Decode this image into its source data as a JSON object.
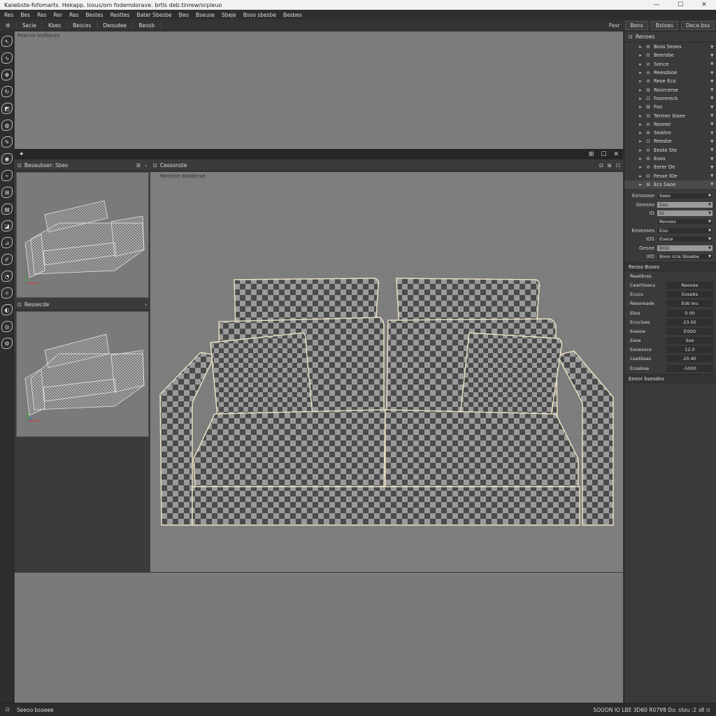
{
  "window": {
    "title": "Kaiwbste-fofomarts. Hekapp. losus/om fodemdorave. brtls deb.tinrew/orpleuo",
    "controls": [
      "—",
      "☐",
      "✕"
    ]
  },
  "menu": [
    "Res",
    "Bes",
    "Res",
    "Rer",
    "Res",
    "Bestes",
    "Resttes",
    "Bater Sbesbe",
    "Beo",
    "Bseuse",
    "Sbeje",
    "Bsoo sbesbe",
    "Besbes"
  ],
  "toolbar": {
    "items": [
      "Secie",
      "Kbes",
      "Besces",
      "Deoudee",
      "Beosb"
    ],
    "right": [
      "Fesr",
      "Bens",
      "Bstoes",
      "Dece.bss"
    ]
  },
  "top_viewport": {
    "label": "Reecne lesfbsces"
  },
  "left_panel": {
    "top_header": "Besaubser: Sbes",
    "bottom_header": "Ressecde"
  },
  "main_viewport": {
    "header": "Cessonste",
    "label": "Remece Isiteberse"
  },
  "right_panel": {
    "title": "Renoes",
    "outliner": [
      {
        "icon": "⊕",
        "label": "Boss Seoes",
        "sel": false
      },
      {
        "icon": "⊟",
        "label": "Beersbe",
        "sel": false
      },
      {
        "icon": "⊘",
        "label": "Sonce",
        "sel": false
      },
      {
        "icon": "⊖",
        "label": "Reesdsoe",
        "sel": false
      },
      {
        "icon": "⊚",
        "label": "Rese Eco",
        "sel": false
      },
      {
        "icon": "⊞",
        "label": "Roorcerse",
        "sel": false
      },
      {
        "icon": "⊡",
        "label": "Foorereck",
        "sel": false
      },
      {
        "icon": "⊠",
        "label": "Foo",
        "sel": false
      },
      {
        "icon": "⊟",
        "label": "Termer blsee",
        "sel": false
      },
      {
        "icon": "⊘",
        "label": "Rooner",
        "sel": false
      },
      {
        "icon": "⊕",
        "label": "Seaitre",
        "sel": false
      },
      {
        "icon": "⊡",
        "label": "Reesbe",
        "sel": false
      },
      {
        "icon": "⊖",
        "label": "Eeste Ste",
        "sel": false
      },
      {
        "icon": "⊕",
        "label": "Eoos",
        "sel": false
      },
      {
        "icon": "⊘",
        "label": "Eerer De",
        "sel": false
      },
      {
        "icon": "⊟",
        "label": "Fesse IDe",
        "sel": false
      },
      {
        "icon": "⊠",
        "label": "Ecs Saoo",
        "sel": true
      }
    ],
    "props": [
      {
        "k": "Esnssose",
        "v": "Saeo",
        "light": false
      },
      {
        "k": "Geeseo",
        "v": "Eeo",
        "light": true
      },
      {
        "k": "IO",
        "v": "IO",
        "light": true
      },
      {
        "k": "",
        "v": "Renoes",
        "light": false
      },
      {
        "k": "Eeseoses",
        "v": "Eoo",
        "light": false
      },
      {
        "k": "IOS",
        "v": "Eoece",
        "light": false
      },
      {
        "k": "Gesoe",
        "v": "BOD",
        "light": true
      },
      {
        "k": "IXO",
        "v": "Boon Icre Sboebe",
        "light": false
      }
    ],
    "attr_title": "Reoso Boses",
    "attr_sub": "Reaitbres",
    "attrs": [
      {
        "k": "Cearhtsecs",
        "v": "Reooee"
      },
      {
        "k": "Ecucs",
        "v": "Eosebs"
      },
      {
        "k": "Reeoreade",
        "v": "Eob Ieu"
      },
      {
        "k": "Ebre",
        "v": "0       00"
      },
      {
        "k": "Ecncloes",
        "v": "23.00"
      },
      {
        "k": "Eeeioe",
        "v": "E0D0"
      },
      {
        "k": "Esoe",
        "v": "Soo"
      },
      {
        "k": "Eeoesoce",
        "v": "12.0"
      },
      {
        "k": "Ceetbses",
        "v": "20.40"
      },
      {
        "k": "Ecseboe",
        "v": "-5000"
      }
    ],
    "bottom_title": "Eeeor bsesdes"
  },
  "status": {
    "left": "Seeoo bsoeee",
    "right": "SOOON IO LBE 3D60 R07Ɐ8  Do. stou  :2 ɜ8 ⊙"
  }
}
